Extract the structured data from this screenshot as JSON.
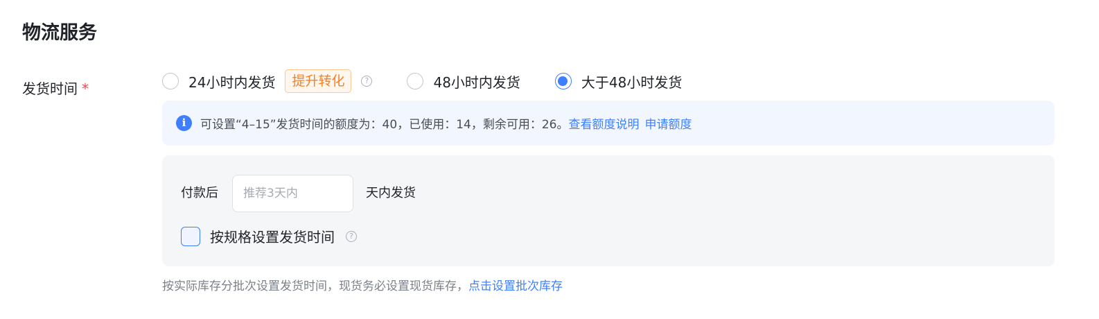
{
  "section": {
    "title": "物流服务"
  },
  "shipping_time": {
    "label": "发货时间",
    "required_mark": "*",
    "options": [
      {
        "label": "24小时内发货",
        "checked": false,
        "tag": "提升转化",
        "help_icon": "question-icon"
      },
      {
        "label": "48小时内发货",
        "checked": false
      },
      {
        "label": "大于48小时发货",
        "checked": true
      }
    ]
  },
  "quota_info": {
    "icon": "info-icon",
    "text": "可设置“4–15”发货时间的额度为：40，已使用：14，剩余可用：26。",
    "link_view": "查看额度说明",
    "link_apply": "申请额度"
  },
  "settings": {
    "pay_label": "付款后",
    "days_input": {
      "value": "",
      "placeholder": "推荐3天内"
    },
    "days_suffix": "天内发货",
    "by_spec": {
      "label": "按规格设置发货时间",
      "checked": false,
      "help_icon": "question-icon"
    }
  },
  "footer": {
    "note": "按实际库存分批次设置发货时间，现货务必设置现货库存，",
    "link": "点击设置批次库存"
  },
  "colors": {
    "accent": "#3d7fff",
    "required": "#f5414d",
    "tag_text": "#ff7d1f",
    "info_bg": "#f2f6ff",
    "panel_bg": "#f5f6f8"
  }
}
